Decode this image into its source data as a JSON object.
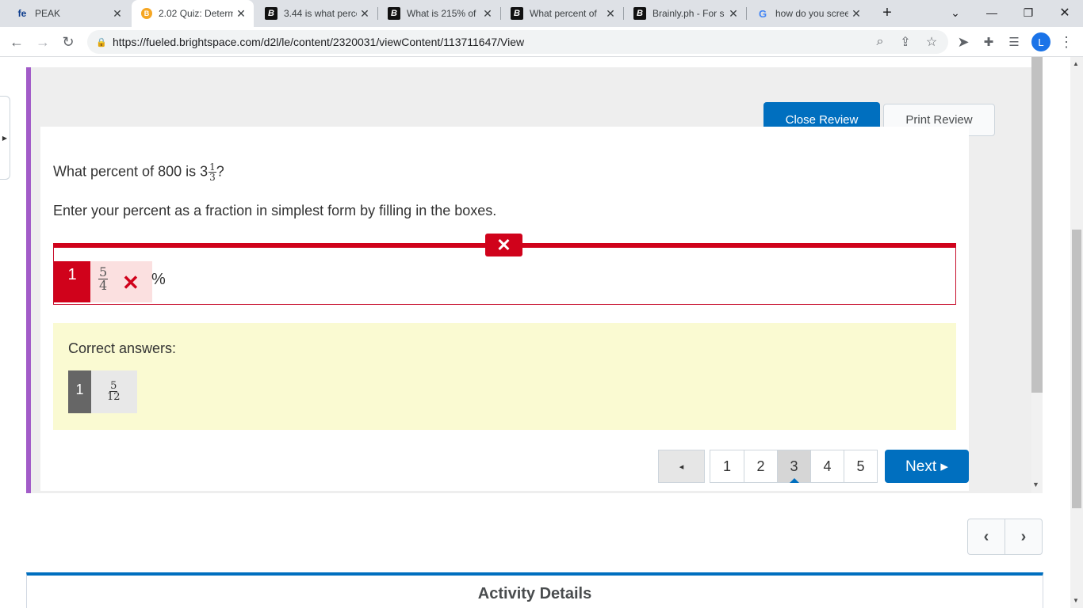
{
  "browser": {
    "tabs": [
      {
        "title": "PEAK",
        "favicon": "fe"
      },
      {
        "title": "2.02 Quiz: Determ",
        "favicon": "B"
      },
      {
        "title": "3.44 is what perce",
        "favicon": "B"
      },
      {
        "title": "What is 215% of",
        "favicon": "B"
      },
      {
        "title": "What percent of",
        "favicon": "B"
      },
      {
        "title": "Brainly.ph - For s",
        "favicon": "B"
      },
      {
        "title": "how do you scree",
        "favicon": "G"
      }
    ],
    "url": "https://fueled.brightspace.com/d2l/le/content/2320031/viewContent/113711647/View",
    "profile_initial": "L"
  },
  "quiz": {
    "close_review_label": "Close Review",
    "print_review_label": "Print Review",
    "question_prefix": "What percent of 800 is 3",
    "question_frac_num": "1",
    "question_frac_den": "3",
    "question_suffix": "?",
    "instruction": "Enter your percent as a fraction in simplest form by filling in the boxes.",
    "response": {
      "whole": "1",
      "num": "5",
      "den": "4",
      "unit": "%"
    },
    "correct_label": "Correct answers:",
    "correct": {
      "whole": "1",
      "num": "5",
      "den": "12"
    },
    "pages": [
      "1",
      "2",
      "3",
      "4",
      "5"
    ],
    "current_page": "3",
    "next_label": "Next ▸",
    "prev_label": "◂"
  },
  "activity_title": "Activity Details",
  "colors": {
    "brand": "#006fbf",
    "error": "#d0021b",
    "accent": "#a25cc8"
  }
}
